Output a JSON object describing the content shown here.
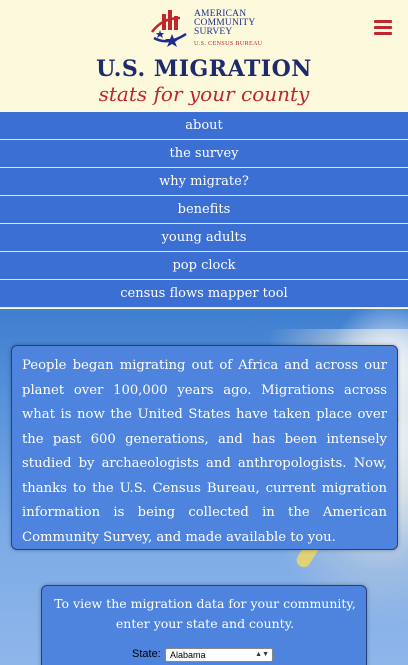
{
  "header": {
    "logo_line1": "AMERICAN",
    "logo_line2": "COMMUNITY",
    "logo_line3": "SURVEY",
    "logo_sub": "U.S. CENSUS BUREAU",
    "title": "U.S. MIGRATION",
    "subtitle": "stats for your county",
    "menu_icon": "hamburger-icon"
  },
  "nav": {
    "items": [
      {
        "label": "about"
      },
      {
        "label": "the survey"
      },
      {
        "label": "why migrate?"
      },
      {
        "label": "benefits"
      },
      {
        "label": "young adults"
      },
      {
        "label": "pop clock"
      },
      {
        "label": "census flows mapper tool"
      }
    ]
  },
  "intro": {
    "text": "People began migrating out of Africa and across our planet over 100,000 years ago. Migrations across what is now the United States have taken place over the past 600 generations, and has been intensely studied by archaeologists and anthropologists. Now, thanks to the U.S. Census Bureau, current migration information is being collected in the American Community Survey, and made available to you."
  },
  "form": {
    "instructions": "To view the migration data for your community, enter your state and county.",
    "state_label": "State:",
    "state_value": "Alabama"
  },
  "colors": {
    "navy": "#1d2a6b",
    "red": "#c0272d",
    "nav_blue": "#3b6fd4",
    "cream": "#fdf9dc"
  }
}
